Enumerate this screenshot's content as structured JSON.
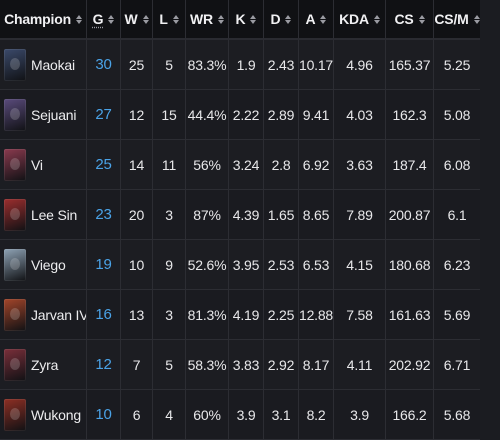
{
  "table": {
    "headers": [
      "Champion",
      "G",
      "W",
      "L",
      "WR",
      "K",
      "D",
      "A",
      "KDA",
      "CS",
      "CS/M"
    ],
    "rows": [
      {
        "champion": "Maokai",
        "g": "30",
        "w": "25",
        "l": "5",
        "wr": "83.3%",
        "k": "1.9",
        "d": "2.43",
        "a": "10.17",
        "kda": "4.96",
        "cs": "165.37",
        "csm": "5.25",
        "portrait_color": "#3b4a6b"
      },
      {
        "champion": "Sejuani",
        "g": "27",
        "w": "12",
        "l": "15",
        "wr": "44.4%",
        "k": "2.22",
        "d": "2.89",
        "a": "9.41",
        "kda": "4.03",
        "cs": "162.3",
        "csm": "5.08",
        "portrait_color": "#5a4b7c"
      },
      {
        "champion": "Vi",
        "g": "25",
        "w": "14",
        "l": "11",
        "wr": "56%",
        "k": "3.24",
        "d": "2.8",
        "a": "6.92",
        "kda": "3.63",
        "cs": "187.4",
        "csm": "6.08",
        "portrait_color": "#8a3a4e"
      },
      {
        "champion": "Lee Sin",
        "g": "23",
        "w": "20",
        "l": "3",
        "wr": "87%",
        "k": "4.39",
        "d": "1.65",
        "a": "8.65",
        "kda": "7.89",
        "cs": "200.87",
        "csm": "6.1",
        "portrait_color": "#9c2e2e"
      },
      {
        "champion": "Viego",
        "g": "19",
        "w": "10",
        "l": "9",
        "wr": "52.6%",
        "k": "3.95",
        "d": "2.53",
        "a": "6.53",
        "kda": "4.15",
        "cs": "180.68",
        "csm": "6.23",
        "portrait_color": "#8fa3b5"
      },
      {
        "champion": "Jarvan IV",
        "g": "16",
        "w": "13",
        "l": "3",
        "wr": "81.3%",
        "k": "4.19",
        "d": "2.25",
        "a": "12.88",
        "kda": "7.58",
        "cs": "161.63",
        "csm": "5.69",
        "portrait_color": "#a3452a"
      },
      {
        "champion": "Zyra",
        "g": "12",
        "w": "7",
        "l": "5",
        "wr": "58.3%",
        "k": "3.83",
        "d": "2.92",
        "a": "8.17",
        "kda": "4.11",
        "cs": "202.92",
        "csm": "6.71",
        "portrait_color": "#7a2f3a"
      },
      {
        "champion": "Wukong",
        "g": "10",
        "w": "6",
        "l": "4",
        "wr": "60%",
        "k": "3.9",
        "d": "3.1",
        "a": "8.2",
        "kda": "3.9",
        "cs": "166.2",
        "csm": "5.68",
        "portrait_color": "#8e2f24"
      }
    ]
  },
  "colors": {
    "games_accent": "#4aa3e8",
    "header_bg": "#101114",
    "row_bg": "#1b1c21",
    "grid_line": "#2c2d33"
  }
}
